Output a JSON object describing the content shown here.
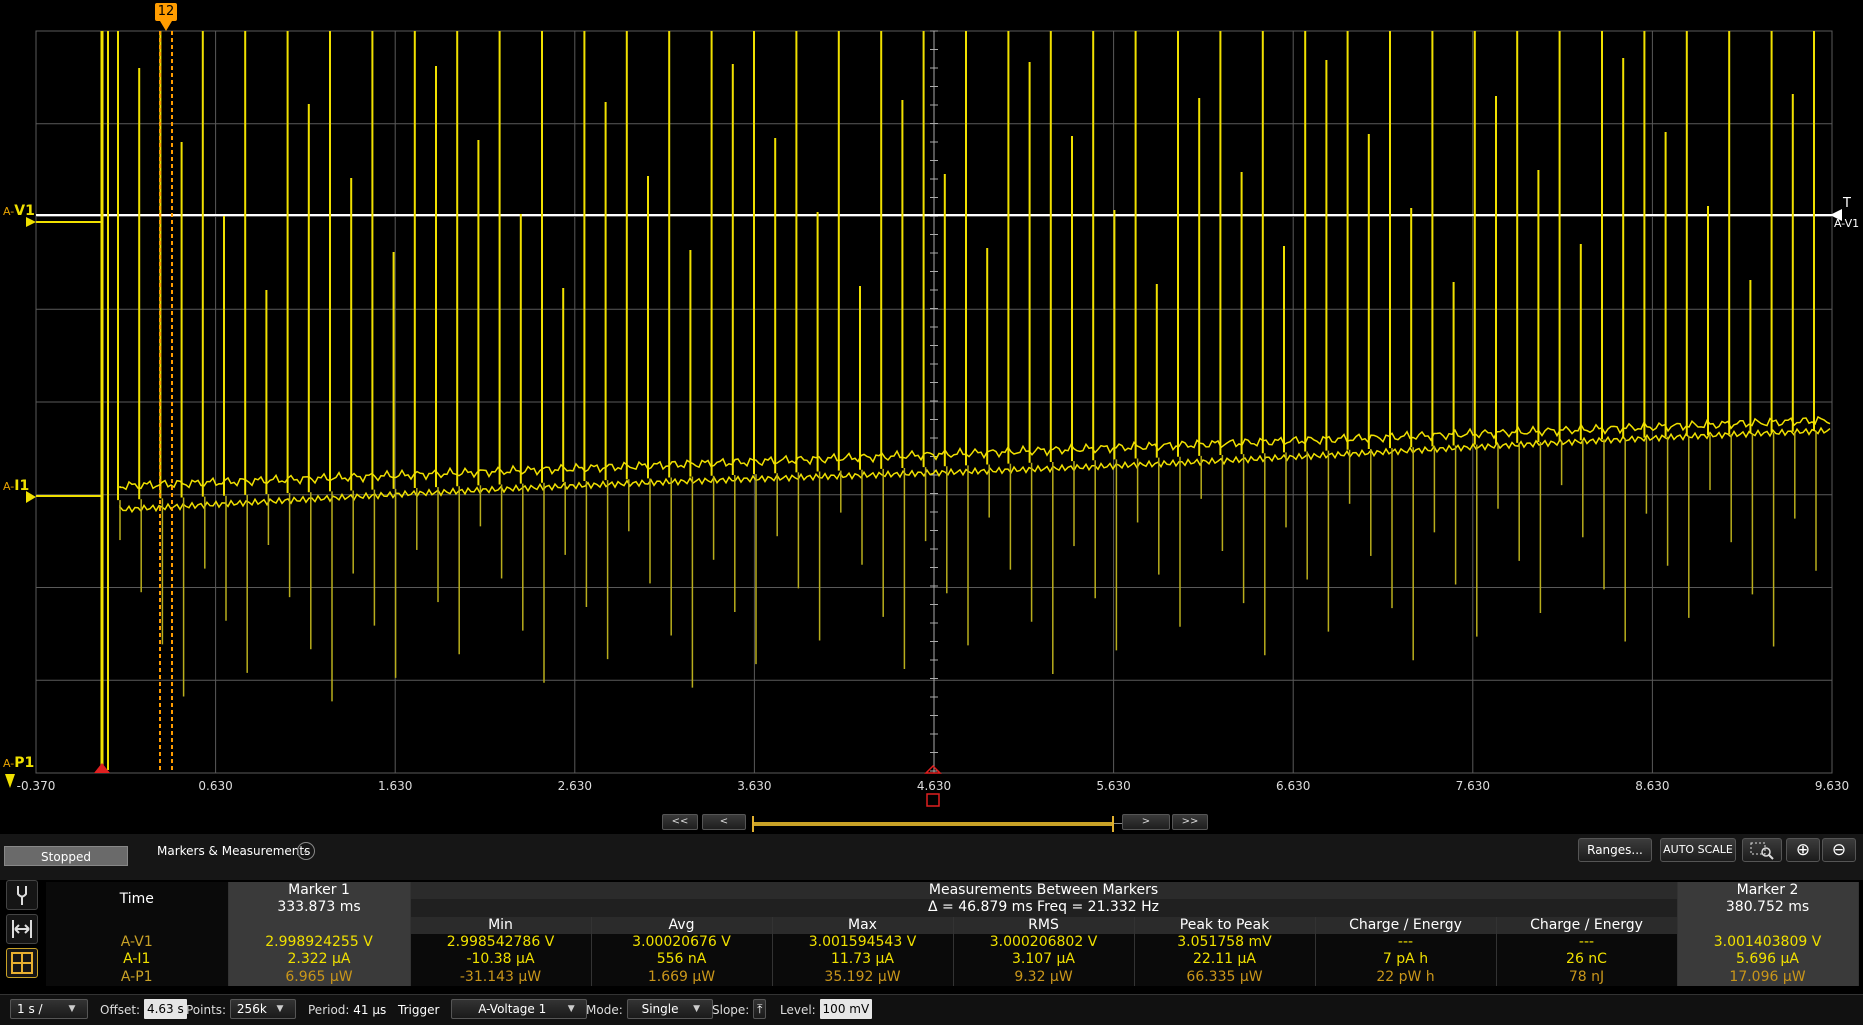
{
  "colors": {
    "trace": "#f0e000",
    "marker": "#ff9c00",
    "grid": "#5a5a5a",
    "axis": "#ffffff"
  },
  "channels": {
    "v1": {
      "prefix": "A-",
      "name": "V1"
    },
    "i1": {
      "prefix": "A-",
      "name": "I1"
    },
    "p1": {
      "prefix": "A-",
      "name": "P1"
    },
    "right_label": "A-V1",
    "trigger_glyph": "T"
  },
  "marker_flag": "12",
  "x_ticks": [
    "-0.370",
    "0.630",
    "1.630",
    "2.630",
    "3.630",
    "4.630",
    "5.630",
    "6.630",
    "7.630",
    "8.630",
    "9.630"
  ],
  "nav": {
    "first": "<<",
    "prev": "<",
    "next": ">",
    "last": ">>"
  },
  "toolbar": {
    "status": "Stopped",
    "mm_title": "Markers & Measurements",
    "mm_chev": "⌄",
    "ranges": "Ranges...",
    "autoscale": "AUTO SCALE",
    "zoom_in": "⊕",
    "zoom_out": "⊖"
  },
  "table": {
    "time_label": "Time",
    "marker1": {
      "title": "Marker 1",
      "time": "333.873 ms",
      "v1": "2.998924255 V",
      "i1": "2.322 μA",
      "p1": "6.965 μW"
    },
    "marker2": {
      "title": "Marker 2",
      "time": "380.752 ms",
      "v1": "3.001403809 V",
      "i1": "5.696 μA",
      "p1": "17.096 μW"
    },
    "between": {
      "title": "Measurements Between Markers",
      "delta": "Δ = 46.879 ms   Freq = 21.332 Hz"
    },
    "row_labels": {
      "v1": "A-V1",
      "i1": "A-I1",
      "p1": "A-P1"
    },
    "columns": [
      {
        "name": "Min",
        "v1": "2.998542786 V",
        "i1": "-10.38 μA",
        "p1": "-31.143 μW"
      },
      {
        "name": "Avg",
        "v1": "3.00020676 V",
        "i1": "556 nA",
        "p1": "1.669 μW"
      },
      {
        "name": "Max",
        "v1": "3.001594543 V",
        "i1": "11.73 μA",
        "p1": "35.192 μW"
      },
      {
        "name": "RMS",
        "v1": "3.000206802 V",
        "i1": "3.107 μA",
        "p1": "9.32 μW"
      },
      {
        "name": "Peak to Peak",
        "v1": "3.051758 mV",
        "i1": "22.11 μA",
        "p1": "66.335 μW"
      },
      {
        "name": "Charge / Energy",
        "v1": "---",
        "i1": "7 pA h",
        "p1": "22 pW h"
      },
      {
        "name": "Charge / Energy",
        "v1": "---",
        "i1": "26 nC",
        "p1": "78 nJ"
      }
    ]
  },
  "bottom": {
    "timebase": "1 s /",
    "offset_label": "Offset:",
    "offset_value": "4.63 s",
    "points_label": "Points:",
    "points_value": "256k",
    "period_label": "Period:",
    "period_value": "41 μs",
    "trigger_label": "Trigger",
    "trigger_source": "A-Voltage 1",
    "mode_label": "Mode:",
    "mode_value": "Single",
    "slope_label": "Slope:",
    "slope_glyph": "⤒",
    "level_label": "Level:",
    "level_value": "100 mV",
    "dropdown": "▼"
  }
}
